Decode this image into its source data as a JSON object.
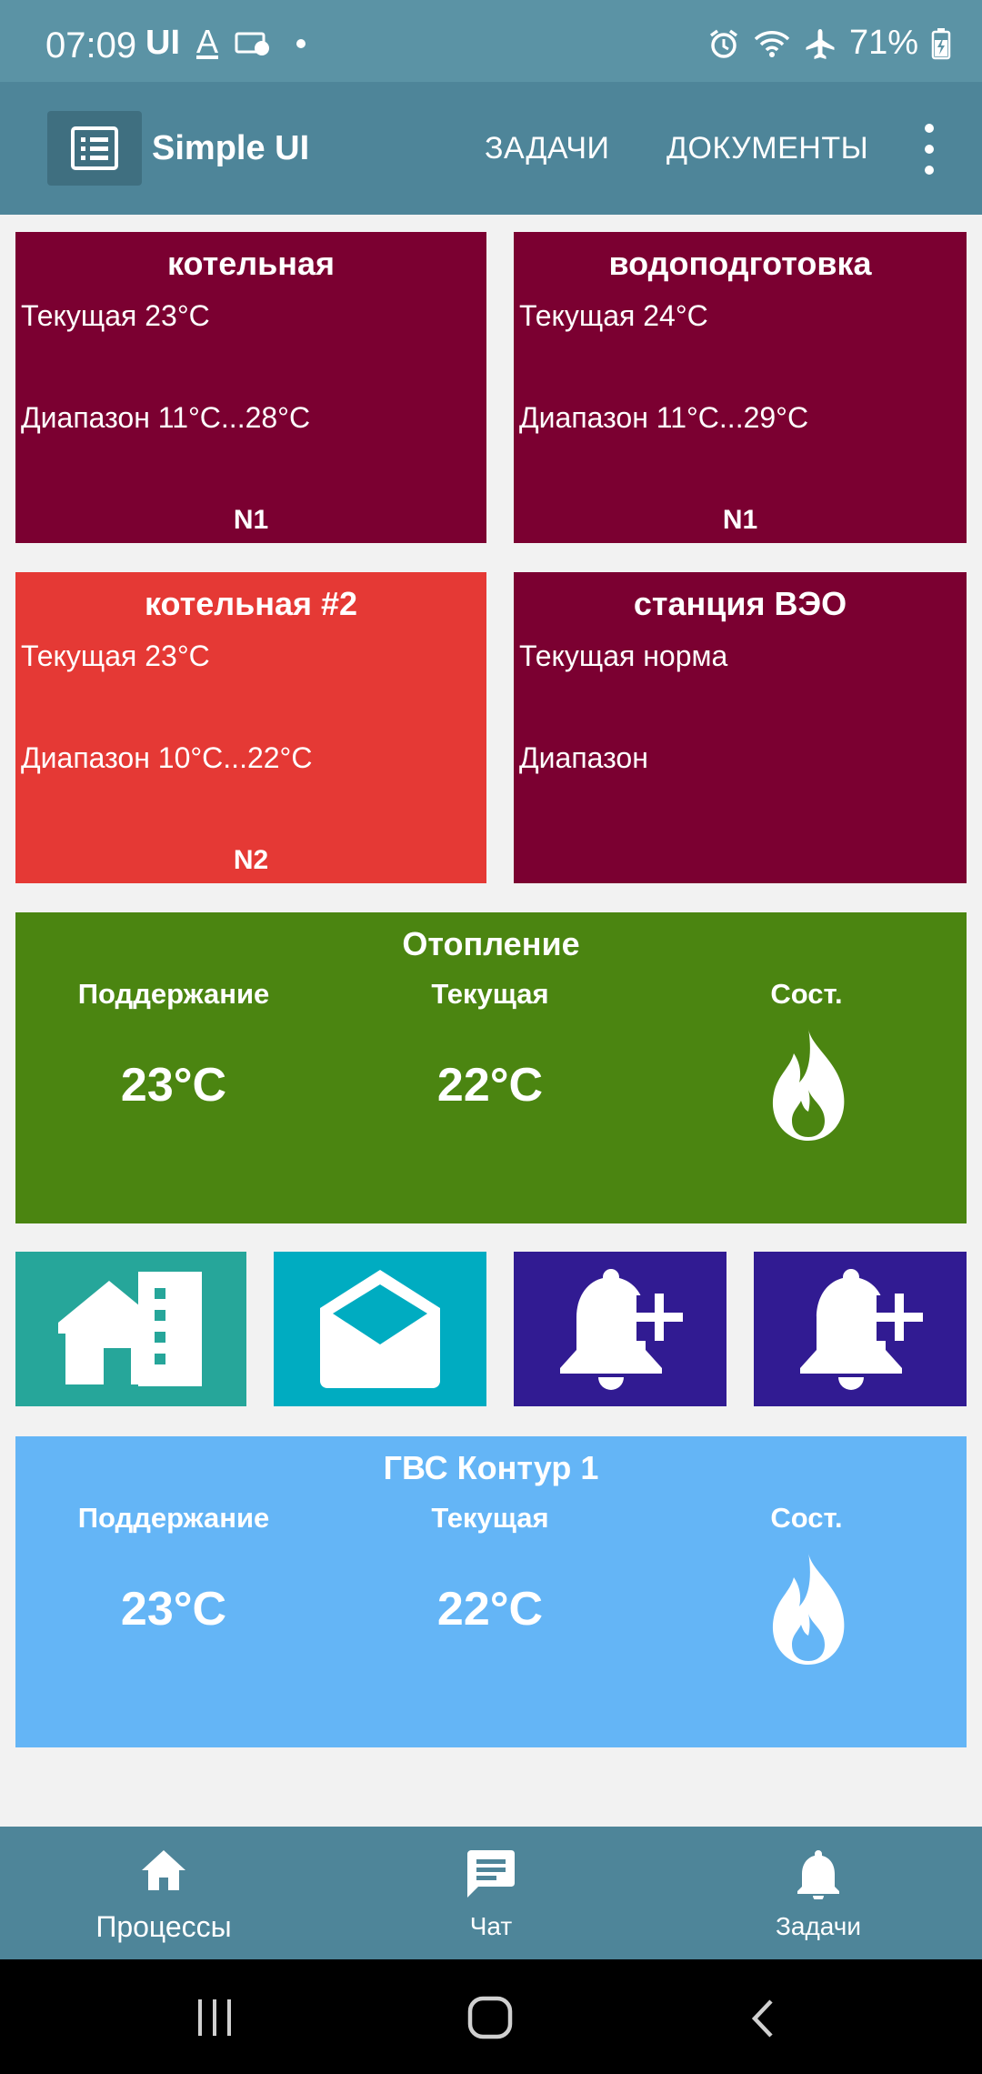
{
  "status_bar": {
    "time": "07:09",
    "left_icons": [
      "ui-text",
      "font-a-icon",
      "screencast-icon",
      "dot"
    ],
    "ui_text": "UI",
    "battery": "71%"
  },
  "app_bar": {
    "title": "Simple UI",
    "tabs": [
      "ЗАДАЧИ",
      "ДОКУМЕНТЫ"
    ]
  },
  "tiles": [
    {
      "title": "котельная",
      "line1": "Текущая 23°C",
      "line2": "Диапазон 11°C...28°C",
      "footer": "N1",
      "color": "#7b0031"
    },
    {
      "title": "водоподготовка",
      "line1": "Текущая 24°C",
      "line2": "Диапазон 11°C...29°C",
      "footer": "N1",
      "color": "#7b0031"
    },
    {
      "title": "котельная #2",
      "line1": "Текущая 23°C",
      "line2": "Диапазон 10°C...22°C",
      "footer": "N2",
      "color": "#e53935"
    },
    {
      "title": "станция ВЭО",
      "line1": "Текущая норма",
      "line2": "Диапазон",
      "footer": "",
      "color": "#7b0031"
    }
  ],
  "heating": {
    "title": "Отопление",
    "maintain_label": "Поддержание",
    "current_label": "Текущая",
    "state_label": "Сост.",
    "maintain_value": "23°C",
    "current_value": "22°C",
    "state_icon": "flame-icon",
    "color": "#4b8511"
  },
  "hot_water": {
    "title": "ГВС Контур 1",
    "maintain_label": "Поддержание",
    "current_label": "Текущая",
    "state_label": "Сост.",
    "maintain_value": "23°C",
    "current_value": "22°C",
    "state_icon": "flame-icon",
    "color": "#64b5f6"
  },
  "action_buttons": [
    {
      "icon": "building-icon",
      "color": "#26a69a"
    },
    {
      "icon": "mail-icon",
      "color": "#00acc1"
    },
    {
      "icon": "bell-plus-icon",
      "color": "#311b92"
    },
    {
      "icon": "bell-plus-icon",
      "color": "#311b92"
    }
  ],
  "bottom_nav": [
    {
      "label": "Процессы",
      "icon": "home-icon"
    },
    {
      "label": "Чат",
      "icon": "chat-icon"
    },
    {
      "label": "Задачи",
      "icon": "bell-icon"
    }
  ],
  "system_nav": [
    "recents-icon",
    "home-circle-icon",
    "back-icon"
  ]
}
